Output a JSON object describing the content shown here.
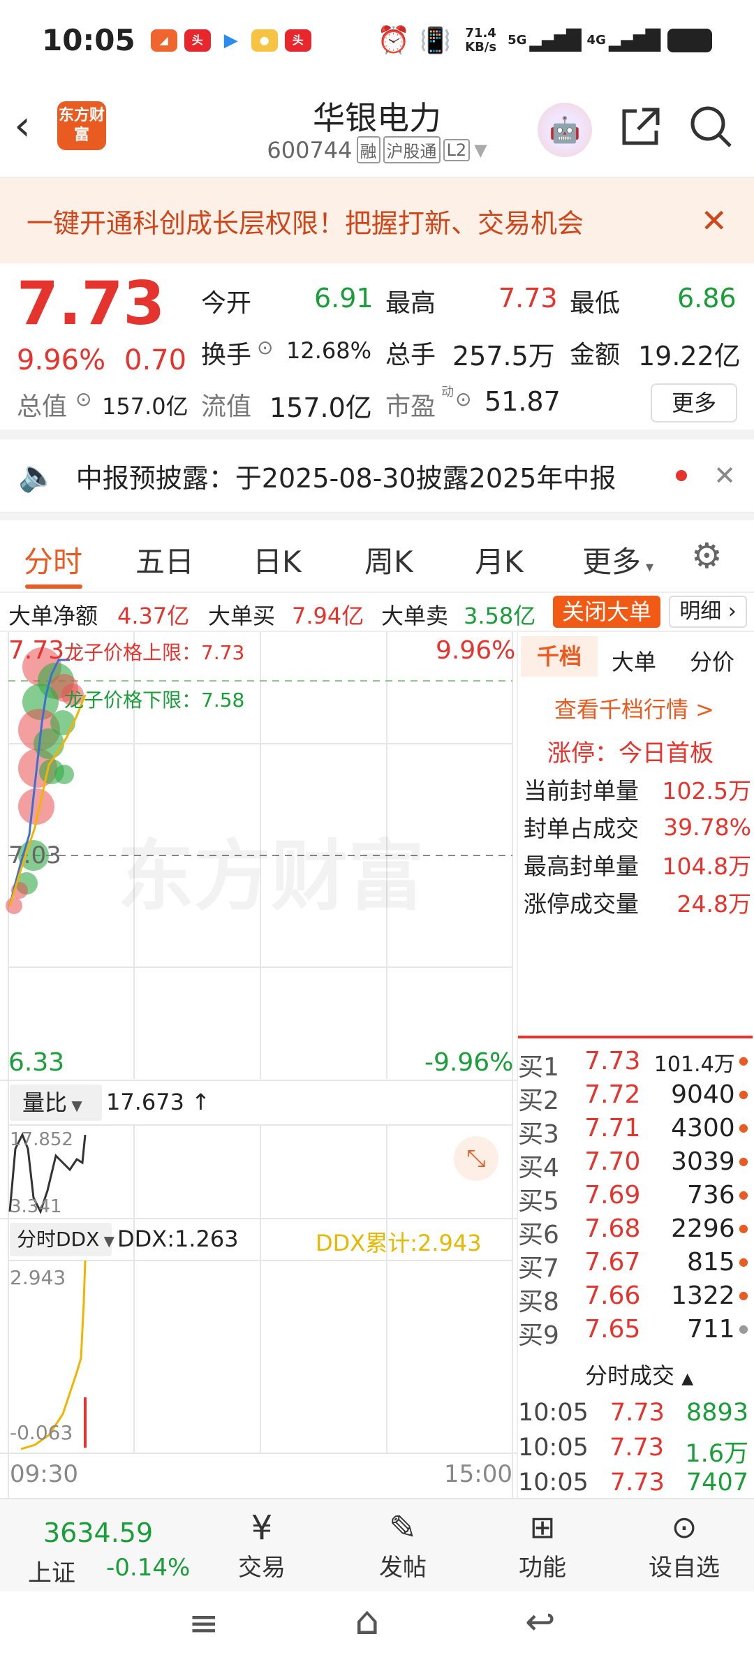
{
  "status_bar": {
    "time": "10:05",
    "net_speed": "71.4",
    "net_unit": "KB/s",
    "net_5g": "5G",
    "net_4g": "4G"
  },
  "header": {
    "logo_text": "东方财富",
    "title": "华银电力",
    "code": "600744",
    "badge_rong": "融",
    "badge_hgt": "沪股通",
    "badge_l2": "L2"
  },
  "banner": {
    "text": "一键开通科创成长层权限！把握打新、交易机会"
  },
  "quote": {
    "price": "7.73",
    "change_pct": "9.96%",
    "change": "0.70",
    "open_label": "今开",
    "open": "6.91",
    "high_label": "最高",
    "high": "7.73",
    "low_label": "最低",
    "low": "6.86",
    "turnover_label": "换手",
    "turnover": "12.68%",
    "volume_label": "总手",
    "volume": "257.5万",
    "amount_label": "金额",
    "amount": "19.22亿",
    "mcap_label": "总值",
    "mcap": "157.0亿",
    "float_label": "流值",
    "float": "157.0亿",
    "pe_label": "市盈",
    "pe_sup": "动",
    "pe": "51.87",
    "more_button": "更多"
  },
  "notice": {
    "text": "中报预披露：于2025-08-30披露2025年中报"
  },
  "tabs": [
    "分时",
    "五日",
    "日K",
    "周K",
    "月K",
    "更多"
  ],
  "big_order": {
    "net_label": "大单净额",
    "net": "4.37亿",
    "buy_label": "大单买",
    "buy": "7.94亿",
    "sell_label": "大单卖",
    "sell": "3.58亿",
    "close_button": "关闭大单",
    "detail_button": "明细"
  },
  "chart": {
    "top_price": "7.73",
    "top_pct": "9.96%",
    "bottom_price": "6.33",
    "bottom_pct": "-9.96%",
    "mid_price": "7.03",
    "upper_limit_label": "龙子价格上限：7.73",
    "lower_limit_label": "龙子价格下限：7.58",
    "watermark": "东方财富",
    "volratio_label": "量比",
    "volratio_value": "17.673 ↑",
    "volratio_top": "17.852",
    "volratio_bottom": "3.341",
    "ddx_label": "分时DDX",
    "ddx_value": "DDX:1.263",
    "ddx_cum": "DDX累计:2.943",
    "ddx_top": "2.943",
    "ddx_bottom": "-0.063",
    "time_start": "09:30",
    "time_end": "15:00"
  },
  "right_panel": {
    "tabs": [
      "千档",
      "大单",
      "分价"
    ],
    "view_link": "查看千档行情 >",
    "limit_title": "涨停：今日首板",
    "stats": [
      {
        "label": "当前封单量",
        "value": "102.5万"
      },
      {
        "label": "封单占成交",
        "value": "39.78%"
      },
      {
        "label": "最高封单量",
        "value": "104.8万"
      },
      {
        "label": "涨停成交量",
        "value": "24.8万"
      }
    ],
    "bids": [
      {
        "label": "买1",
        "price": "7.73",
        "vol": "101.4万"
      },
      {
        "label": "买2",
        "price": "7.72",
        "vol": "9040"
      },
      {
        "label": "买3",
        "price": "7.71",
        "vol": "4300"
      },
      {
        "label": "买4",
        "price": "7.70",
        "vol": "3039"
      },
      {
        "label": "买5",
        "price": "7.69",
        "vol": "736"
      },
      {
        "label": "买6",
        "price": "7.68",
        "vol": "2296"
      },
      {
        "label": "买7",
        "price": "7.67",
        "vol": "815"
      },
      {
        "label": "买8",
        "price": "7.66",
        "vol": "1322"
      },
      {
        "label": "买9",
        "price": "7.65",
        "vol": "711"
      }
    ],
    "trades_title": "分时成交",
    "trades": [
      {
        "time": "10:05",
        "price": "7.73",
        "vol": "8893"
      },
      {
        "time": "10:05",
        "price": "7.73",
        "vol": "1.6万"
      },
      {
        "time": "10:05",
        "price": "7.73",
        "vol": "7407"
      }
    ]
  },
  "bottom_nav": {
    "index_value": "3634.59",
    "index_name": "上证",
    "index_change": "-0.14%",
    "trade": "交易",
    "post": "发帖",
    "func": "功能",
    "watch": "设自选"
  }
}
